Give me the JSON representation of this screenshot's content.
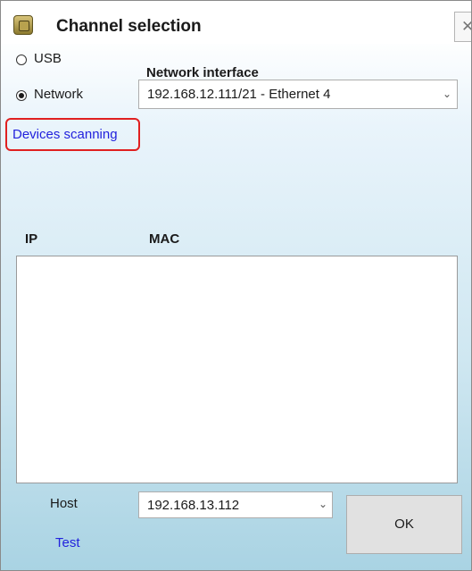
{
  "window": {
    "title": "Channel selection",
    "close_symbol": "✕",
    "icon": "app-icon"
  },
  "connection": {
    "usb_label": "USB",
    "usb_selected": false,
    "network_label": "Network",
    "network_selected": true
  },
  "network_interface": {
    "label": "Network interface",
    "value": "192.168.12.111/21 - Ethernet 4"
  },
  "scan": {
    "link_label": "Devices scanning",
    "highlight_color": "#e02020"
  },
  "device_list": {
    "columns": [
      "IP",
      "MAC"
    ],
    "rows": []
  },
  "host": {
    "label": "Host",
    "value": "192.168.13.112",
    "test_label": "Test"
  },
  "actions": {
    "ok_label": "OK"
  },
  "colors": {
    "link": "#2222dd",
    "background_bottom": "#a9d3e3"
  }
}
